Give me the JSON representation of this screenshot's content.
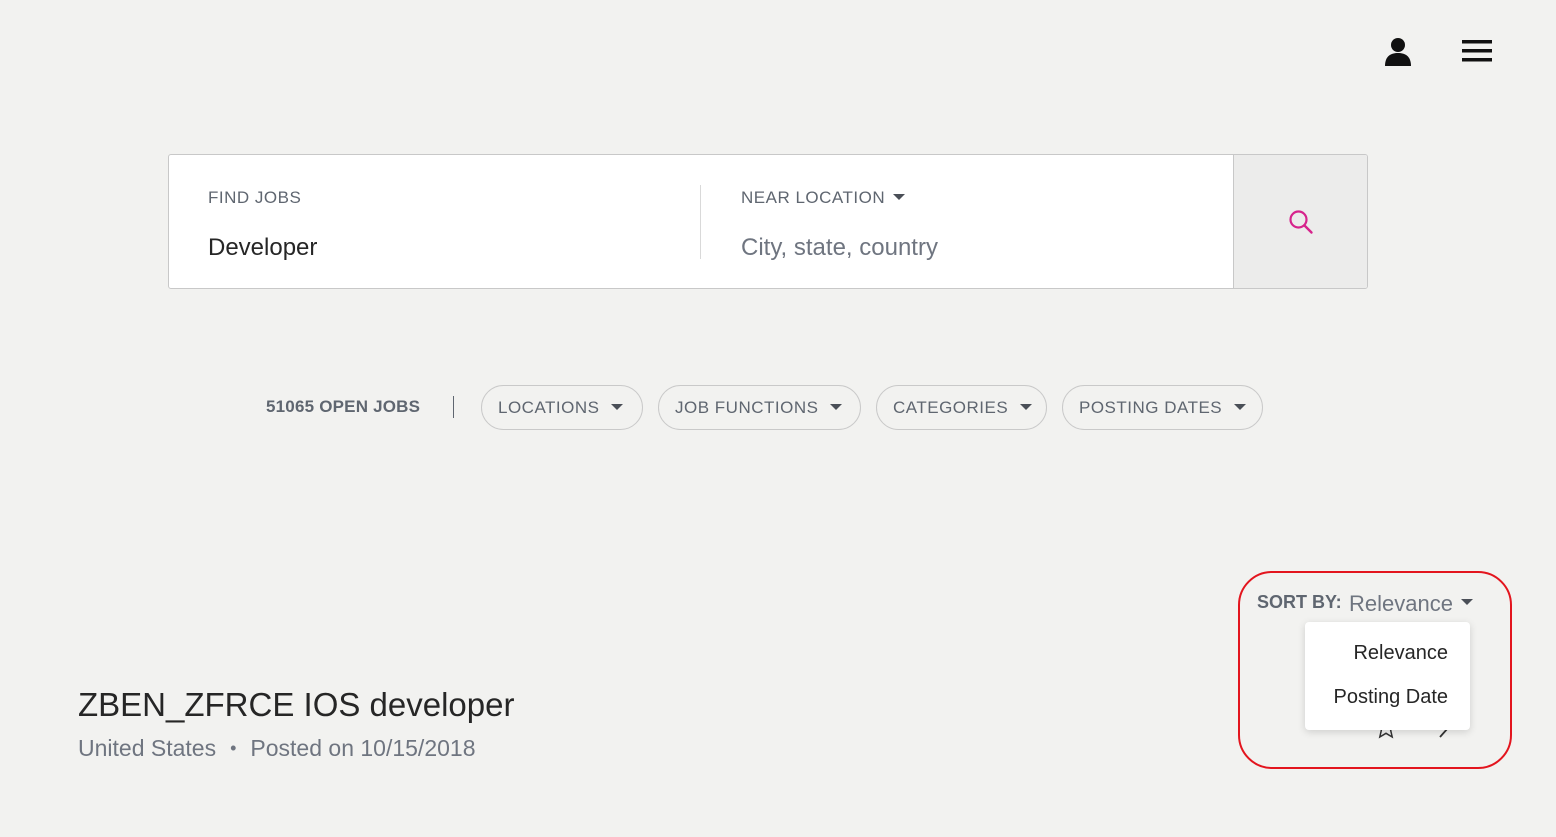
{
  "header": {
    "user_icon": "user-icon",
    "menu_icon": "hamburger-menu-icon"
  },
  "search": {
    "keyword_label": "FIND JOBS",
    "keyword_value": "Developer",
    "location_label": "NEAR LOCATION",
    "location_placeholder": "City, state, country",
    "location_value": "",
    "search_icon": "search-icon",
    "accent_color": "#d6248c"
  },
  "filters": {
    "open_jobs": "51065 OPEN JOBS",
    "pills": [
      "LOCATIONS",
      "JOB FUNCTIONS",
      "CATEGORIES",
      "POSTING DATES"
    ]
  },
  "sort": {
    "label": "SORT BY:",
    "selected": "Relevance",
    "options": [
      "Relevance",
      "Posting Date"
    ]
  },
  "results": [
    {
      "title": "ZBEN_ZFRCE IOS developer",
      "location": "United States",
      "separator": "•",
      "posted": "Posted on 10/15/2018"
    }
  ],
  "annotation": {
    "highlight_color": "#e3151e"
  }
}
